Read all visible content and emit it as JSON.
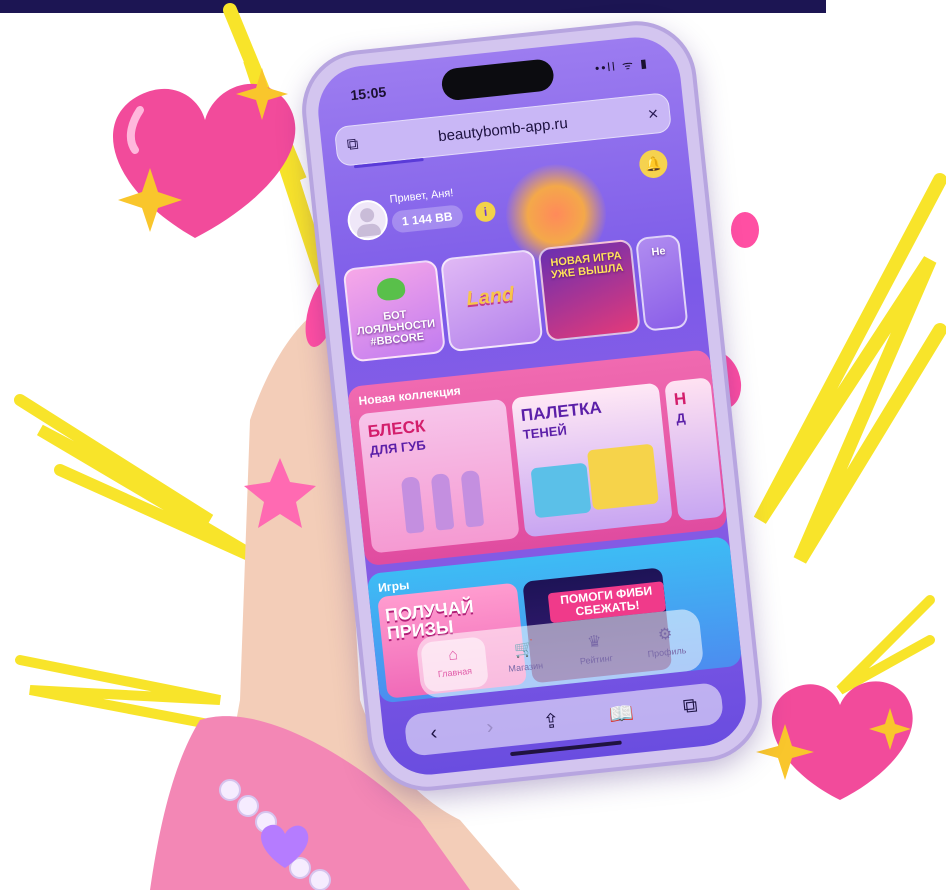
{
  "status": {
    "time": "15:05",
    "icons": "••ll ᯤ ▮"
  },
  "browser": {
    "url": "beautybomb-app.ru",
    "close": "×",
    "tabs_glyph": "⧉",
    "back": "‹",
    "forward": "›",
    "share": "⇪",
    "bookmarks": "📖"
  },
  "user": {
    "greeting": "Привет, Аня!",
    "balance": "1 144 BB"
  },
  "stories": [
    {
      "label": "БОТ ЛОЯЛЬНОСТИ #BBCORE"
    },
    {
      "label": "Land"
    },
    {
      "label": "НОВАЯ ИГРА УЖЕ ВЫШЛА"
    },
    {
      "label": "Не"
    }
  ],
  "collection": {
    "title": "Новая коллекция",
    "cards": [
      {
        "title": "БЛЕСК",
        "subtitle": "ДЛЯ ГУБ"
      },
      {
        "title": "ПАЛЕТКА",
        "subtitle": "ТЕНЕЙ"
      },
      {
        "title": "Н",
        "subtitle": "Д"
      }
    ]
  },
  "games": {
    "title": "Игры",
    "cards": [
      {
        "title": "ПОЛУЧАЙ ПРИЗЫ"
      },
      {
        "title": "ПОМОГИ ФИБИ СБЕЖАТЬ!"
      }
    ]
  },
  "tabbar": [
    {
      "label": "Главная",
      "icon": "home-icon"
    },
    {
      "label": "Магазин",
      "icon": "cart-icon"
    },
    {
      "label": "Рейтинг",
      "icon": "trophy-icon"
    },
    {
      "label": "Профиль",
      "icon": "gear-icon"
    }
  ],
  "colors": {
    "accent": "#e05aa8",
    "background": "#7b5ae8",
    "topbar": "#1c1553",
    "yellow": "#f8e42a",
    "heart": "#f24b9b"
  }
}
